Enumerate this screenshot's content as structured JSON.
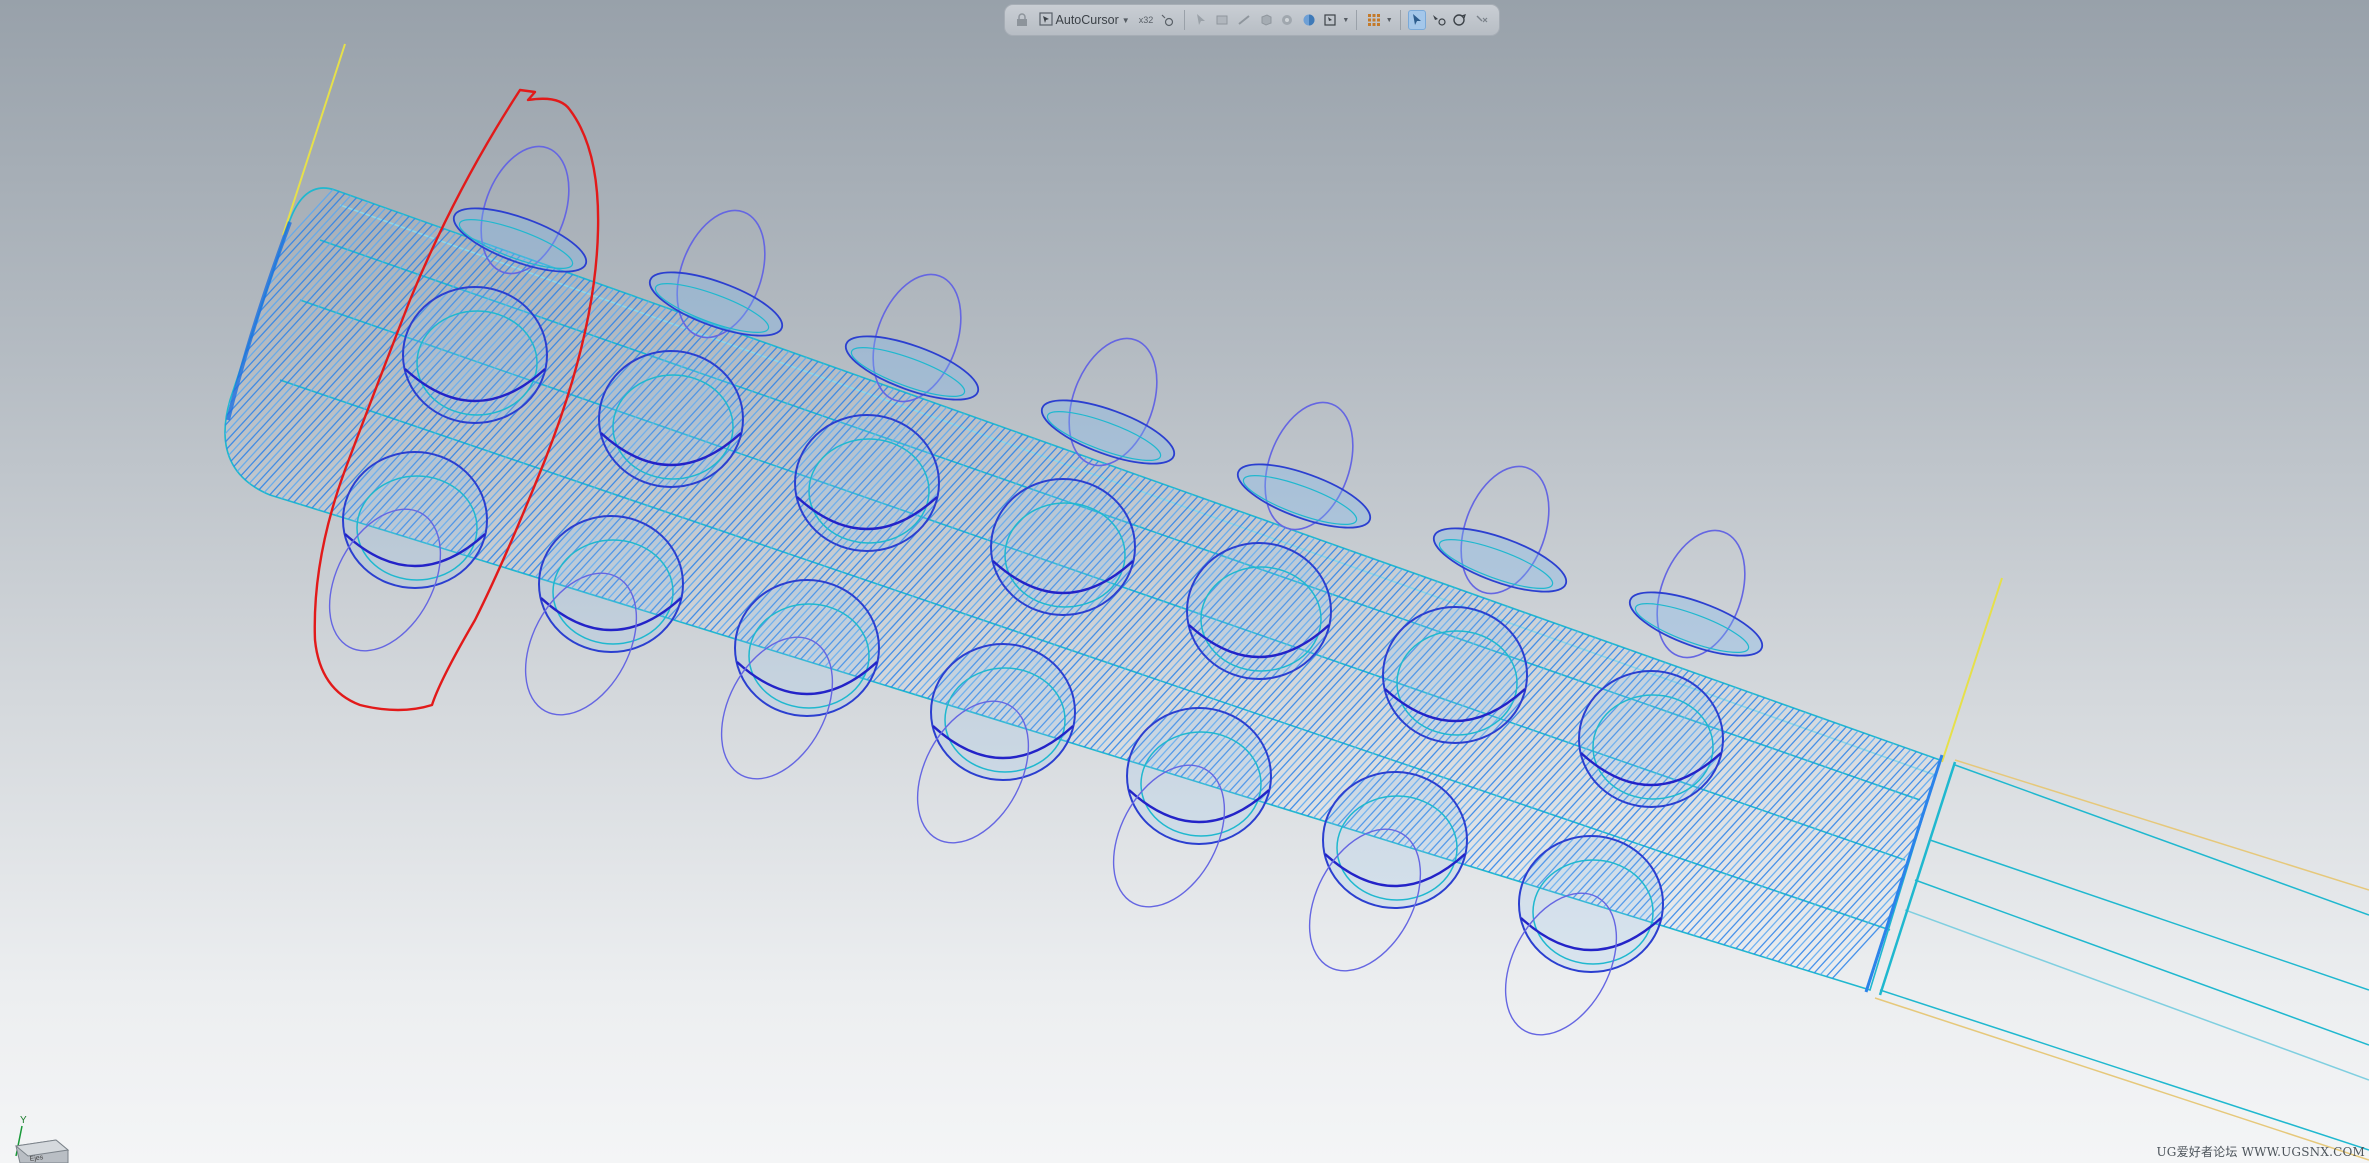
{
  "toolbar": {
    "selection_filter": "AutoCursor",
    "scale_label": "x32",
    "colors": {
      "background": "#c0c6cc",
      "active": "#a4c7ea"
    },
    "icons": [
      "lock-icon",
      "select-filter-icon",
      "scale-icon",
      "snap-point-icon",
      "select-arrow-icon",
      "select-face-icon",
      "select-edge-icon",
      "select-body-icon",
      "select-feature-icon",
      "shaded-view-icon",
      "view-orient-icon",
      "grid-icon",
      "pointer-icon",
      "rotate-view-icon",
      "pan-icon"
    ]
  },
  "scene": {
    "colors": {
      "toolpath_dense": "#1f7bea",
      "toolpath_light": "#4ea2f0",
      "hole_outline": "#5a5be0",
      "hole_dark": "#2323c8",
      "edge_cyan": "#1fb8cf",
      "axis_yellow": "#e6e04a",
      "annotation_red": "#e21a1a"
    },
    "triad_label": "Y",
    "triad_cube_label": "Ejes"
  },
  "watermark": "UG爱好者论坛 WWW.UGSNX.COM"
}
